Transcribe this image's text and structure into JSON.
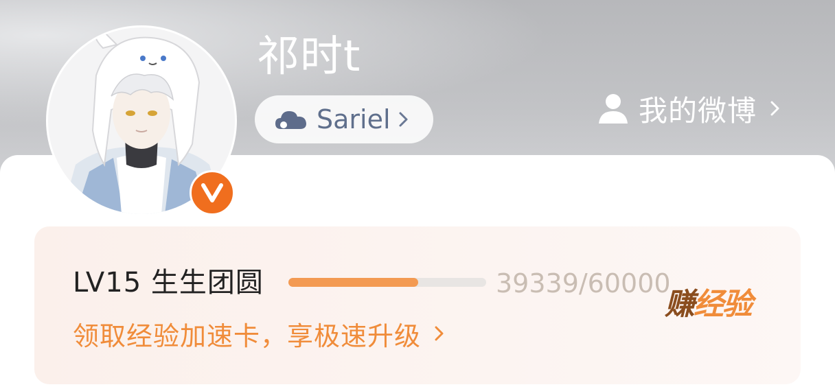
{
  "profile": {
    "username": "祁时t",
    "cloud_tag": "Sariel",
    "my_weibo_label": "我的微博",
    "verified_badge": "V"
  },
  "level": {
    "title": "LV15 生生团圆",
    "progress_text": "39339/60000",
    "progress_value": 39339,
    "progress_max": 60000,
    "promo_text": "领取经验加速卡，享极速升级",
    "earn_label_part1": "赚",
    "earn_label_part2": "经验"
  },
  "icons": {
    "cloud": "cloud-icon",
    "person": "person-icon",
    "chevron": "chevron-right-icon",
    "verified": "verified-badge-icon"
  },
  "colors": {
    "accent_orange": "#f08c3a",
    "badge_orange": "#f06e1e",
    "progress_fill": "#f39a52",
    "card_bg": "#fcf2ee"
  }
}
